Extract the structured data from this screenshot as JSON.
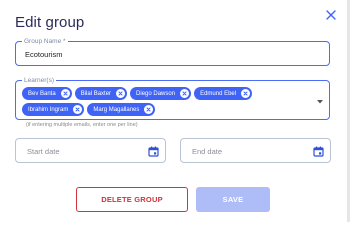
{
  "dialog": {
    "title": "Edit group",
    "close_icon": "close-icon"
  },
  "group_name": {
    "label": "Group Name *",
    "value": "Ecotourism"
  },
  "learners": {
    "label": "Learner(s)",
    "chips": [
      "Bev Banta",
      "Bilal Baxter",
      "Diego Dawson",
      "Edmund Ebel",
      "Ibrahim Ingram",
      "Marg Magallanes"
    ],
    "helper": "(if entering multiple emails, enter one per line)"
  },
  "start_date": {
    "placeholder": "Start date",
    "icon": "calendar-icon"
  },
  "end_date": {
    "placeholder": "End date",
    "icon": "calendar-icon"
  },
  "actions": {
    "delete_label": "DELETE GROUP",
    "save_label": "SAVE"
  },
  "colors": {
    "accent": "#3f64f5",
    "title": "#2b2b5a",
    "danger": "#d0343e",
    "disabled_save": "#aebcf7"
  }
}
